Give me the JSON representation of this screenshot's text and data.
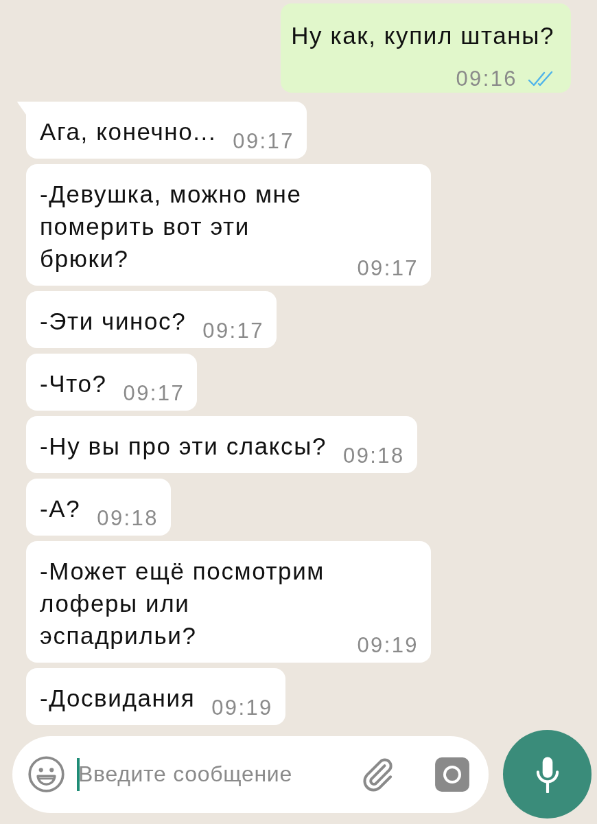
{
  "messages": [
    {
      "kind": "outgoing",
      "tail": false,
      "text": "Ну как, купил штаны?",
      "time": "09:16",
      "read": true
    },
    {
      "kind": "incoming",
      "tail": true,
      "text": "Ага, конечно...",
      "time": "09:17"
    },
    {
      "kind": "incoming",
      "tail": false,
      "text": "-Девушка, можно мне\nпомерить вот эти\nбрюки?",
      "time": "09:17"
    },
    {
      "kind": "incoming",
      "tail": false,
      "text": "-Эти чинос?",
      "time": "09:17"
    },
    {
      "kind": "incoming",
      "tail": false,
      "text": "-Что?",
      "time": "09:17"
    },
    {
      "kind": "incoming",
      "tail": false,
      "text": "-Ну вы про эти слаксы?",
      "time": "09:18"
    },
    {
      "kind": "incoming",
      "tail": false,
      "text": "-А?",
      "time": "09:18"
    },
    {
      "kind": "incoming",
      "tail": false,
      "text": "-Может ещё посмотрим\nлоферы или\nэспадрильи?",
      "time": "09:19"
    },
    {
      "kind": "incoming",
      "tail": false,
      "text": "-Досвидания",
      "time": "09:19"
    }
  ],
  "composer": {
    "placeholder": "Введите сообщение",
    "focused": true
  }
}
